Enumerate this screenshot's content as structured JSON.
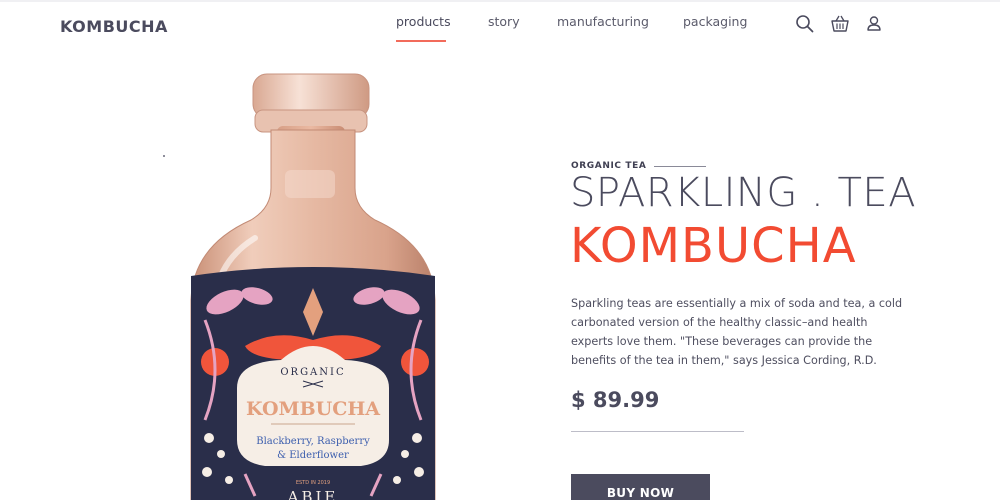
{
  "header": {
    "logo": "KOMBUCHA",
    "nav": [
      "products",
      "story",
      "manufacturing",
      "packaging"
    ],
    "active_nav": "products",
    "icons": [
      "search-icon",
      "basket-icon",
      "user-icon"
    ]
  },
  "hero": {
    "eyebrow": "ORGANIC TEA",
    "title_line1": "SPARKLING . TEA",
    "title_line2": "KOMBUCHA",
    "description": "Sparkling teas are essentially a mix of soda and tea, a cold carbonated version of the healthy classic–and health experts love them. \"These beverages can provide the benefits of the tea in them,\" says Jessica Cording, R.D.",
    "price": "$ 89.99",
    "buy_label": "BUY NOW"
  },
  "bottle_label": {
    "organic": "ORGANIC",
    "brand": "KOMBUCHA",
    "flavor_line1": "Blackberry, Raspberry",
    "flavor_line2": "& Elderflower",
    "est": "ESTD IN 2019",
    "maker": "ABIE"
  },
  "colors": {
    "accent": "#f24b32",
    "dark": "#4b4b5e",
    "label_navy": "#2a2e4a",
    "bottle_peach": "#e6b9a3"
  }
}
